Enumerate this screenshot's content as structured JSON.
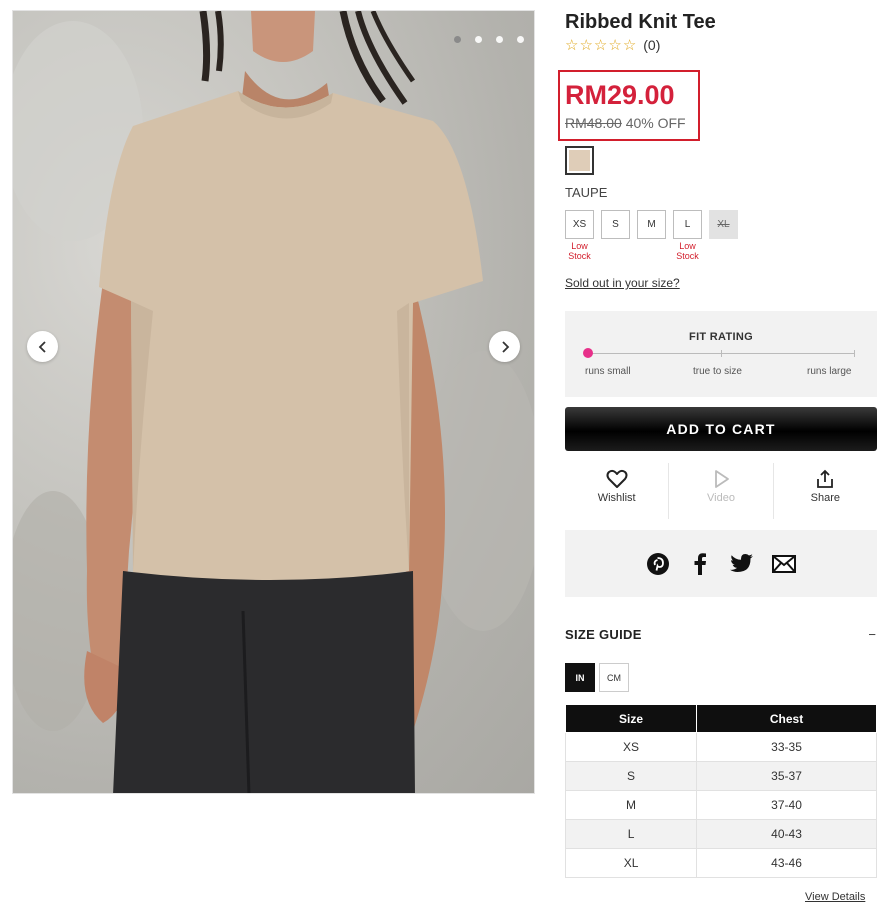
{
  "product": {
    "title": "Ribbed Knit Tee",
    "rating_count": "(0)",
    "price": "RM29.00",
    "original_price": "RM48.00",
    "discount": "40% OFF",
    "color_name": "TAUPE",
    "swatch_color": "#dfcdb8",
    "sold_out_link": "Sold out in your size?"
  },
  "gallery": {
    "image_count": 4,
    "active_index": 0
  },
  "sizes": [
    {
      "label": "XS",
      "note": "Low Stock",
      "available": true
    },
    {
      "label": "S",
      "note": "",
      "available": true
    },
    {
      "label": "M",
      "note": "",
      "available": true
    },
    {
      "label": "L",
      "note": "Low Stock",
      "available": true
    },
    {
      "label": "XL",
      "note": "",
      "available": false
    }
  ],
  "fit_rating": {
    "title": "FIT RATING",
    "labels": [
      "runs small",
      "true to size",
      "runs large"
    ]
  },
  "cart": {
    "label": "ADD TO CART"
  },
  "actions": {
    "wishlist": "Wishlist",
    "video": "Video",
    "share": "Share"
  },
  "social": [
    "pinterest-icon",
    "facebook-icon",
    "twitter-icon",
    "email-icon"
  ],
  "size_guide": {
    "title": "SIZE GUIDE",
    "toggle": "−",
    "units": [
      "IN",
      "CM"
    ],
    "active_unit": "IN",
    "headers": [
      "Size",
      "Chest"
    ],
    "rows": [
      [
        "XS",
        "33-35"
      ],
      [
        "S",
        "35-37"
      ],
      [
        "M",
        "37-40"
      ],
      [
        "L",
        "40-43"
      ],
      [
        "XL",
        "43-46"
      ]
    ],
    "view_details": "View Details"
  },
  "colors": {
    "price_red": "#d4213b",
    "fit_dot": "#e7308a",
    "highlight_border": "#d21e2c"
  }
}
